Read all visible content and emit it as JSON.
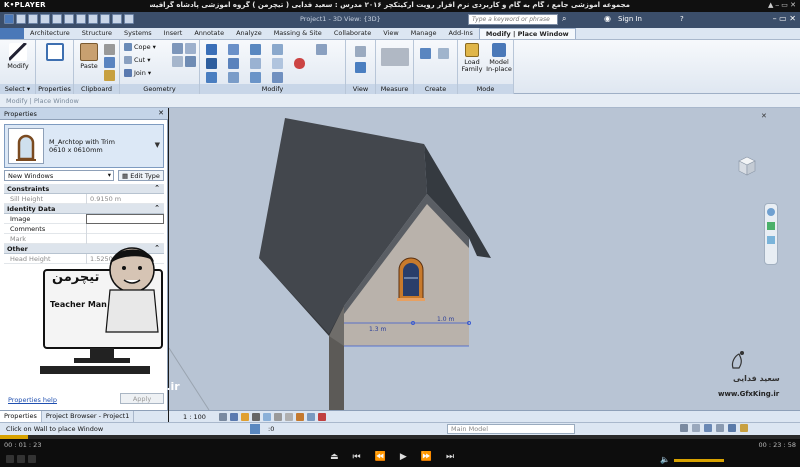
{
  "player": {
    "logo": "K•PLAYER",
    "title": "مجموعه آموزشی جامع ، گام به گام و کاربردی نرم افزار رویت آرکیتکچر ۲۰۱۶ مدرس : سعید فدایی ( تیچرمن ) گروه آموزشی پادشاه گرافیست ها",
    "window_buttons": "▲ ⎯ ▭ ✕",
    "time_elapsed": "00 : 01 : 23",
    "time_total": "00 : 23 : 58",
    "progress": 0.035
  },
  "revit": {
    "doc_title": "Project1 - 3D View: {3D}",
    "search_placeholder": "Type a keyword or phrase",
    "sign_in": "Sign In",
    "help": "?",
    "window_buttons": "– ▭ ✕"
  },
  "ribbon_tabs": [
    "Architecture",
    "Structure",
    "Systems",
    "Insert",
    "Annotate",
    "Analyze",
    "Massing & Site",
    "Collaborate",
    "View",
    "Manage",
    "Add-Ins",
    "Modify | Place Window"
  ],
  "ribbon": {
    "modify": "Modify",
    "select": "Select ▾",
    "properties": "Properties",
    "paste": "Paste",
    "clipboard": "Clipboard",
    "cope": "Cope",
    "cut": "Cut",
    "join": "Join",
    "geometry": "Geometry",
    "modify_panel": "Modify",
    "view": "View",
    "measure": "Measure",
    "create": "Create",
    "load_family": "Load Family",
    "model_inplace": "Model In-place",
    "mode": "Mode"
  },
  "options_bar": "Modify | Place Window",
  "properties": {
    "title": "Properties",
    "close": "✕",
    "type_name_1": "M_Archtop with Trim",
    "type_name_2": "0610 x 0610mm",
    "instance": "New Windows",
    "edit_type": "Edit Type",
    "groups": [
      {
        "name": "Constraints",
        "rows": [
          {
            "k": "Sill Height",
            "v": "0.9150 m",
            "dim": true
          }
        ]
      },
      {
        "name": "Identity Data",
        "rows": [
          {
            "k": "Image",
            "v": "",
            "dim": false
          },
          {
            "k": "Comments",
            "v": "",
            "dim": false
          },
          {
            "k": "Mark",
            "v": "",
            "dim": true
          }
        ]
      },
      {
        "name": "Other",
        "rows": [
          {
            "k": "Head Height",
            "v": "1.5250 m",
            "dim": true
          }
        ]
      }
    ],
    "help_link": "Properties help",
    "apply": "Apply"
  },
  "bottom_tabs": [
    "Properties",
    "Project Browser - Project1"
  ],
  "canvas": {
    "dim_left": "1.3 m",
    "dim_right": "1.0 m"
  },
  "watermark": {
    "logo_text": "تیچرمن",
    "brand": "Teacher Man",
    "url": "www.TeacherMan.ir",
    "gfx_name": "سعید فدایی",
    "gfx_url": "www.GfxKing.ir"
  },
  "view_control": {
    "scale": "1 : 100"
  },
  "status": {
    "text": "Click on Wall to place Window",
    "model": "Main Model",
    "zero": ":0"
  },
  "colors": {
    "roof": "#43474d",
    "wall": "#b9b2ab",
    "canvas": "#b8c4d4",
    "accent": "#d8a200"
  }
}
